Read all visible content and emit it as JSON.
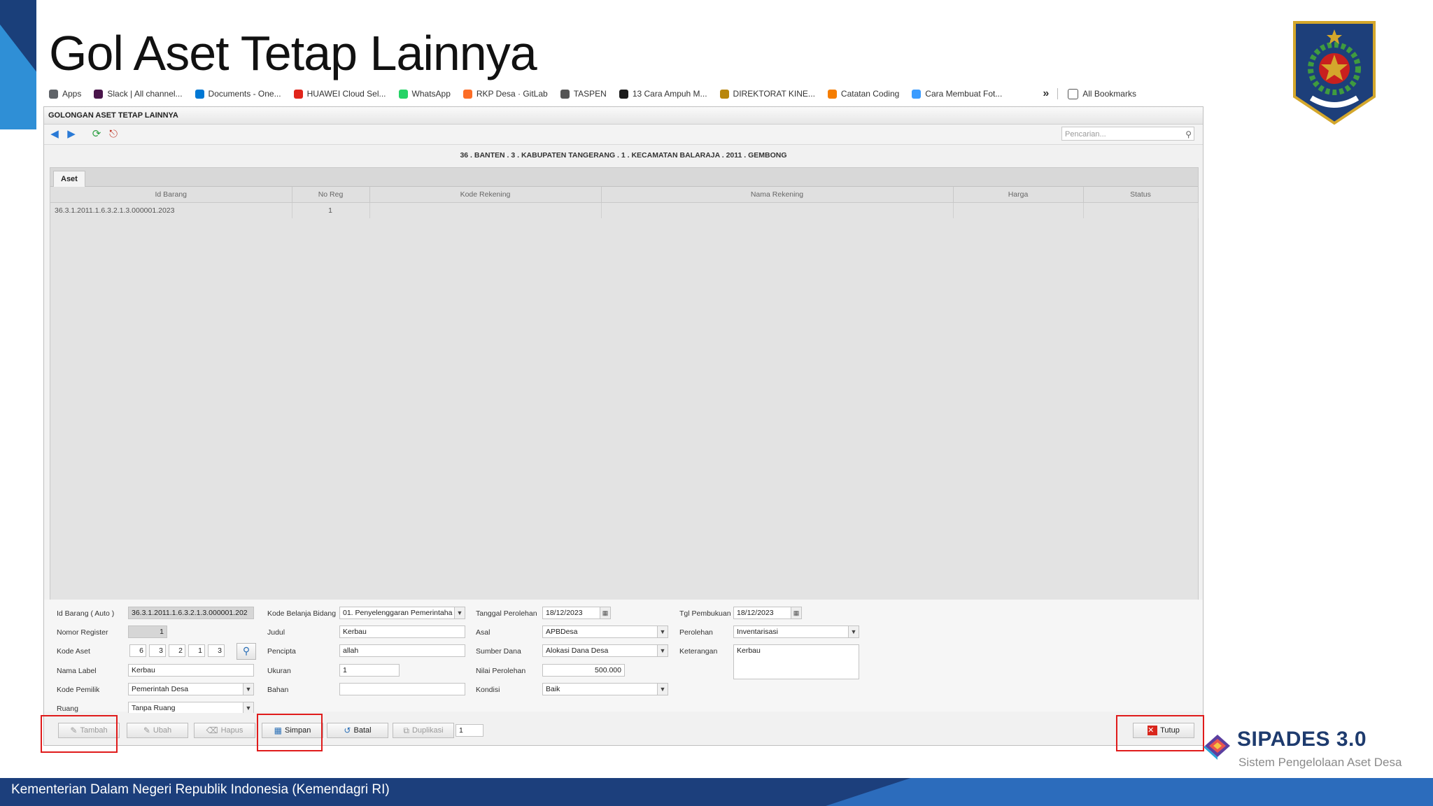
{
  "slide": {
    "title": "Gol Aset Tetap Lainnya",
    "footer": "Kementerian Dalam Negeri Republik Indonesia (Kemendagri RI)"
  },
  "branding": {
    "name": "SIPADES 3.0",
    "tagline": "Sistem Pengelolaan Aset Desa",
    "emblem_text": "KEMENTERIAN DALAM NEGERI"
  },
  "bookmarks": {
    "items": [
      {
        "label": "Apps",
        "icon": "apps-grid-icon",
        "color": "#5f6368"
      },
      {
        "label": "Slack | All channel...",
        "icon": "slack-icon",
        "color": "#4a154b"
      },
      {
        "label": "Documents - One...",
        "icon": "onedrive-icon",
        "color": "#0078d4"
      },
      {
        "label": "HUAWEI Cloud Sel...",
        "icon": "huawei-icon",
        "color": "#e1251b"
      },
      {
        "label": "WhatsApp",
        "icon": "whatsapp-icon",
        "color": "#25d366"
      },
      {
        "label": "RKP Desa · GitLab",
        "icon": "gitlab-icon",
        "color": "#fc6d26"
      },
      {
        "label": "TASPEN",
        "icon": "folder-icon",
        "color": "#555555"
      },
      {
        "label": "13 Cara Ampuh M...",
        "icon": "site-icon",
        "color": "#1a1a1a"
      },
      {
        "label": "DIREKTORAT KINE...",
        "icon": "garuda-icon",
        "color": "#b8860b"
      },
      {
        "label": "Catatan Coding",
        "icon": "blogger-icon",
        "color": "#f57d00"
      },
      {
        "label": "Cara Membuat Fot...",
        "icon": "site-icon",
        "color": "#3b9cff"
      }
    ],
    "more": "»",
    "all": "All Bookmarks"
  },
  "window": {
    "title": "GOLONGAN ASET TETAP LAINNYA",
    "search_placeholder": "Pencarian...",
    "location": "36 . BANTEN . 3 . KABUPATEN TANGERANG . 1 . KECAMATAN BALARAJA . 2011 . GEMBONG",
    "tab": "Aset"
  },
  "grid": {
    "columns": [
      "Id Barang",
      "No Reg",
      "Kode Rekening",
      "Nama Rekening",
      "Harga",
      "Status"
    ],
    "rows": [
      [
        "36.3.1.2011.1.6.3.2.1.3.000001.2023",
        "1",
        "",
        "",
        "",
        ""
      ]
    ]
  },
  "form": {
    "id_barang_label": "Id Barang ( Auto )",
    "id_barang": "36.3.1.2011.1.6.3.2.1.3.000001.202",
    "nomor_register_label": "Nomor Register",
    "nomor_register": "1",
    "kode_aset_label": "Kode Aset",
    "kode_aset": [
      "6",
      "3",
      "2",
      "1",
      "3"
    ],
    "nama_label_label": "Nama Label",
    "nama_label": "Kerbau",
    "kode_pemilik_label": "Kode Pemilik",
    "kode_pemilik": "Pemerintah Desa",
    "ruang_label": "Ruang",
    "ruang": "Tanpa Ruang",
    "kode_belanja_label": "Kode Belanja Bidang",
    "kode_belanja": "01. Penyelenggaran Pemerintaha",
    "judul_label": "Judul",
    "judul": "Kerbau",
    "pencipta_label": "Pencipta",
    "pencipta": "allah",
    "ukuran_label": "Ukuran",
    "ukuran": "1",
    "bahan_label": "Bahan",
    "bahan": "",
    "tanggal_perolehan_label": "Tanggal Perolehan",
    "tanggal_perolehan": "18/12/2023",
    "asal_label": "Asal",
    "asal": "APBDesa",
    "sumber_dana_label": "Sumber Dana",
    "sumber_dana": "Alokasi Dana Desa",
    "nilai_perolehan_label": "Nilai Perolehan",
    "nilai_perolehan": "500.000",
    "kondisi_label": "Kondisi",
    "kondisi": "Baik",
    "tgl_pembukuan_label": "Tgl Pembukuan",
    "tgl_pembukuan": "18/12/2023",
    "perolehan_label": "Perolehan",
    "perolehan": "Inventarisasi",
    "keterangan_label": "Keterangan",
    "keterangan": "Kerbau"
  },
  "buttons": {
    "tambah": "Tambah",
    "ubah": "Ubah",
    "hapus": "Hapus",
    "simpan": "Simpan",
    "batal": "Batal",
    "duplikasi": "Duplikasi",
    "duplikasi_count": "1",
    "tutup": "Tutup"
  },
  "colors": {
    "highlight": "#e01b1b",
    "footer": "#1c3f7c",
    "brand": "#1e3b6e"
  }
}
